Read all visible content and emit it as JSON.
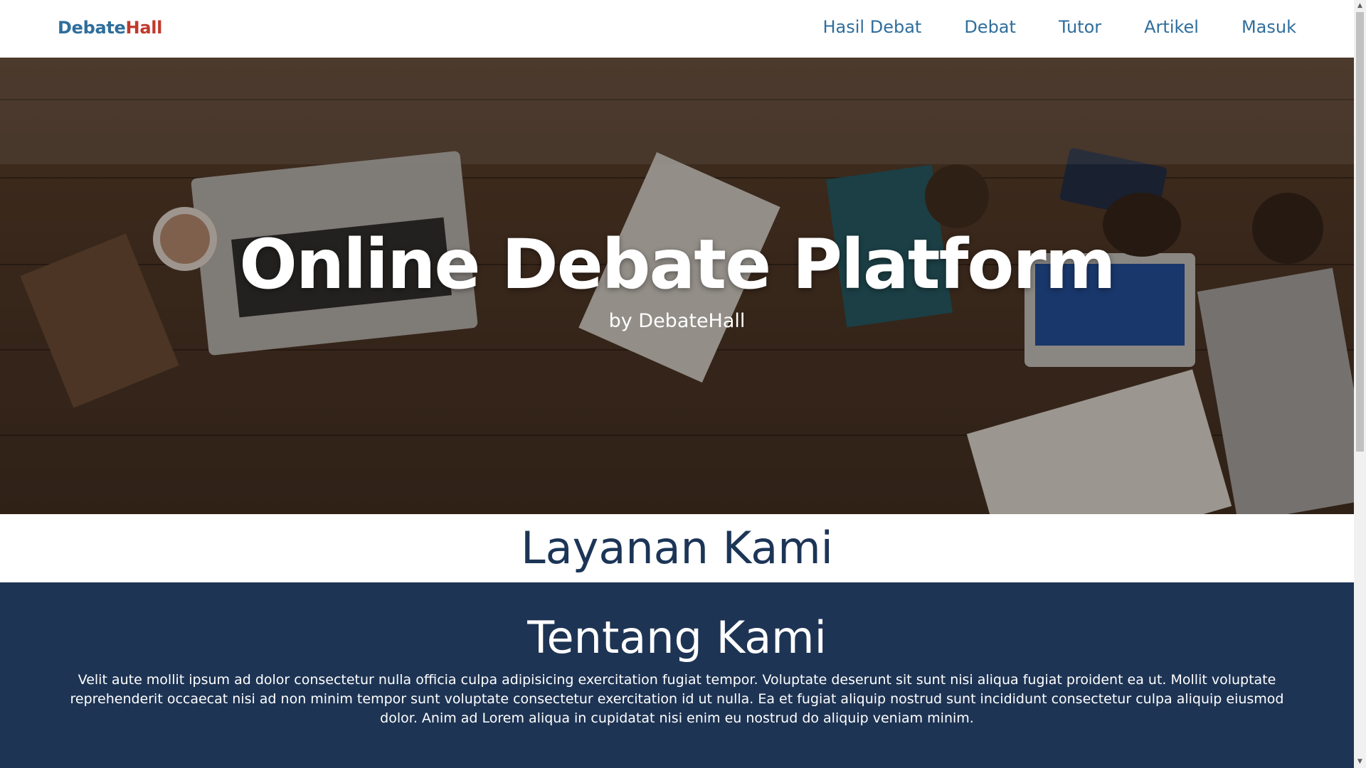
{
  "navbar": {
    "logo_part1": "Debate",
    "logo_part2": "Hall",
    "items": [
      {
        "label": "Hasil Debat"
      },
      {
        "label": "Debat"
      },
      {
        "label": "Tutor"
      },
      {
        "label": "Artikel"
      },
      {
        "label": "Masuk"
      }
    ]
  },
  "hero": {
    "title": "Online Debate Platform",
    "subtitle": "by DebateHall"
  },
  "layanan": {
    "heading": "Layanan Kami"
  },
  "tentang": {
    "heading": "Tentang Kami",
    "body": "Velit aute mollit ipsum ad dolor consectetur nulla officia culpa adipisicing exercitation fugiat tempor. Voluptate deserunt sit sunt nisi aliqua fugiat proident ea ut. Mollit voluptate reprehenderit occaecat nisi ad non minim tempor sunt voluptate consectetur exercitation id ut nulla. Ea et fugiat aliquip nostrud sunt incididunt consectetur culpa aliquip eiusmod dolor. Anim ad Lorem aliqua in cupidatat nisi enim eu nostrud do aliquip veniam minim."
  },
  "colors": {
    "brand_blue": "#2f6e9c",
    "brand_red": "#c0392b",
    "navy": "#1e3454",
    "heading_navy": "#1c3557"
  },
  "icons": {
    "scroll_up": "chevron-up-icon",
    "scroll_down": "chevron-down-icon"
  }
}
